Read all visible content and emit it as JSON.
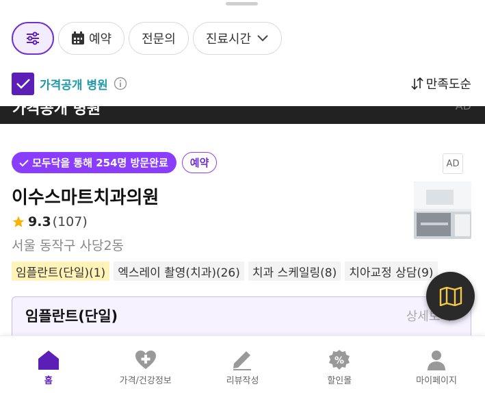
{
  "filters": {
    "chips": [
      {
        "label": "예약",
        "icon": "calendar-icon"
      },
      {
        "label": "전문의"
      },
      {
        "label": "진료시간",
        "icon": "chevron-down-icon"
      }
    ],
    "price_public_label": "가격공개 병원",
    "price_public_checked": true,
    "sort_label": "만족도순"
  },
  "banner": {
    "title": "가격공개 병원",
    "ad_label": "AD"
  },
  "clinic": {
    "visit_badge": "모두닥을 통해 254명 방문완료",
    "reserve_badge": "예약",
    "ad_label": "AD",
    "name": "이수스마트치과의원",
    "rating": "9.3",
    "review_count": "(107)",
    "location": "서울 동작구 사당2동",
    "tags": [
      "임플란트(단일)(1)",
      "엑스레이 촬영(치과)(26)",
      "치과 스케일링(8)",
      "치아교정 상담(9)"
    ]
  },
  "price_card": {
    "title": "임플란트(단일)",
    "detail_label": "상세보기"
  },
  "nav": {
    "items": [
      {
        "label": "홈",
        "icon": "home-icon",
        "active": true
      },
      {
        "label": "가격/건강정보",
        "icon": "heart-plus-icon"
      },
      {
        "label": "리뷰작성",
        "icon": "pencil-icon"
      },
      {
        "label": "할인몰",
        "icon": "discount-icon"
      },
      {
        "label": "마이페이지",
        "icon": "person-icon"
      }
    ]
  },
  "colors": {
    "accent": "#5b1fb8",
    "badge": "#8b3dff",
    "price_label": "#1e9aa8",
    "highlight_tag": "#fff3b8"
  }
}
